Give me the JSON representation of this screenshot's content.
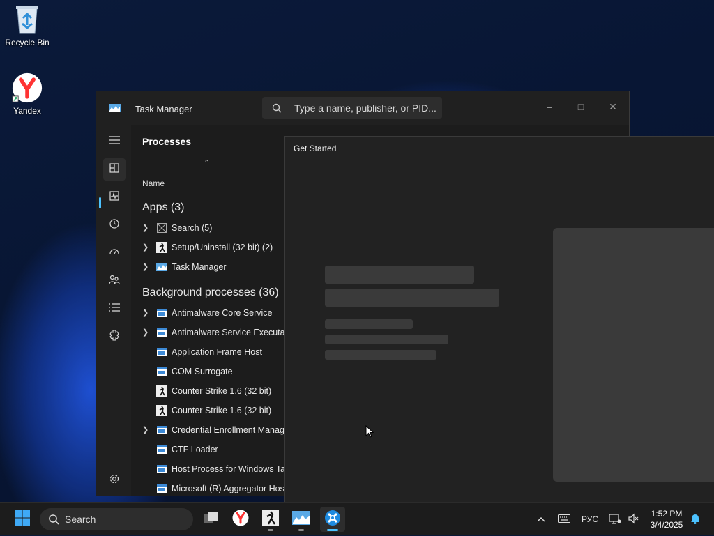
{
  "desktop": {
    "icons": [
      {
        "label": "Recycle Bin",
        "icon": "recycle-bin-icon"
      },
      {
        "label": "Yandex",
        "icon": "yandex-browser-icon"
      }
    ]
  },
  "task_manager": {
    "title": "Task Manager",
    "search_placeholder": "Type a name, publisher, or PID...",
    "window_controls": {
      "minimize": "–",
      "maximize": "□",
      "close": "✕"
    },
    "nav": [
      "hamburger-icon",
      "processes-icon",
      "performance-icon",
      "app-history-icon",
      "startup-apps-icon",
      "users-icon",
      "details-icon",
      "services-icon",
      "settings-icon"
    ],
    "page_heading": "Processes",
    "column_name": "Name",
    "groups": {
      "apps": "Apps (3)",
      "background": "Background processes (36)"
    },
    "apps": [
      {
        "label": "Search (5)",
        "expandable": true,
        "icon": "search-app-icon"
      },
      {
        "label": "Setup/Uninstall (32 bit) (2)",
        "expandable": true,
        "icon": "counter-strike-icon"
      },
      {
        "label": "Task Manager",
        "expandable": true,
        "icon": "task-manager-icon"
      }
    ],
    "background": [
      {
        "label": "Antimalware Core Service",
        "expandable": true,
        "icon": "window-app-icon"
      },
      {
        "label": "Antimalware Service Executable",
        "expandable": true,
        "icon": "window-app-icon"
      },
      {
        "label": "Application Frame Host",
        "expandable": false,
        "icon": "window-app-icon"
      },
      {
        "label": "COM Surrogate",
        "expandable": false,
        "icon": "window-app-icon"
      },
      {
        "label": "Counter Strike 1.6 (32 bit)",
        "expandable": false,
        "icon": "counter-strike-icon"
      },
      {
        "label": "Counter Strike 1.6 (32 bit)",
        "expandable": false,
        "icon": "counter-strike-icon"
      },
      {
        "label": "Credential Enrollment Manager",
        "expandable": true,
        "icon": "window-app-icon"
      },
      {
        "label": "CTF Loader",
        "expandable": false,
        "icon": "window-app-icon"
      },
      {
        "label": "Host Process for Windows Tasks",
        "expandable": false,
        "icon": "window-app-icon"
      },
      {
        "label": "Microsoft (R) Aggregator Host",
        "expandable": false,
        "icon": "window-app-icon"
      }
    ]
  },
  "get_started": {
    "title": "Get Started"
  },
  "taskbar": {
    "search_placeholder": "Search",
    "apps": [
      "start-icon",
      "task-view-icon",
      "yandex-browser-icon",
      "counter-strike-icon",
      "task-manager-icon",
      "get-started-icon"
    ],
    "tray": {
      "language": "РУС",
      "time": "1:52 PM",
      "date": "3/4/2025"
    }
  },
  "colors": {
    "accent": "#4cc2ff",
    "window_bg": "#202020",
    "taskbar_bg": "#1c1c1c"
  }
}
